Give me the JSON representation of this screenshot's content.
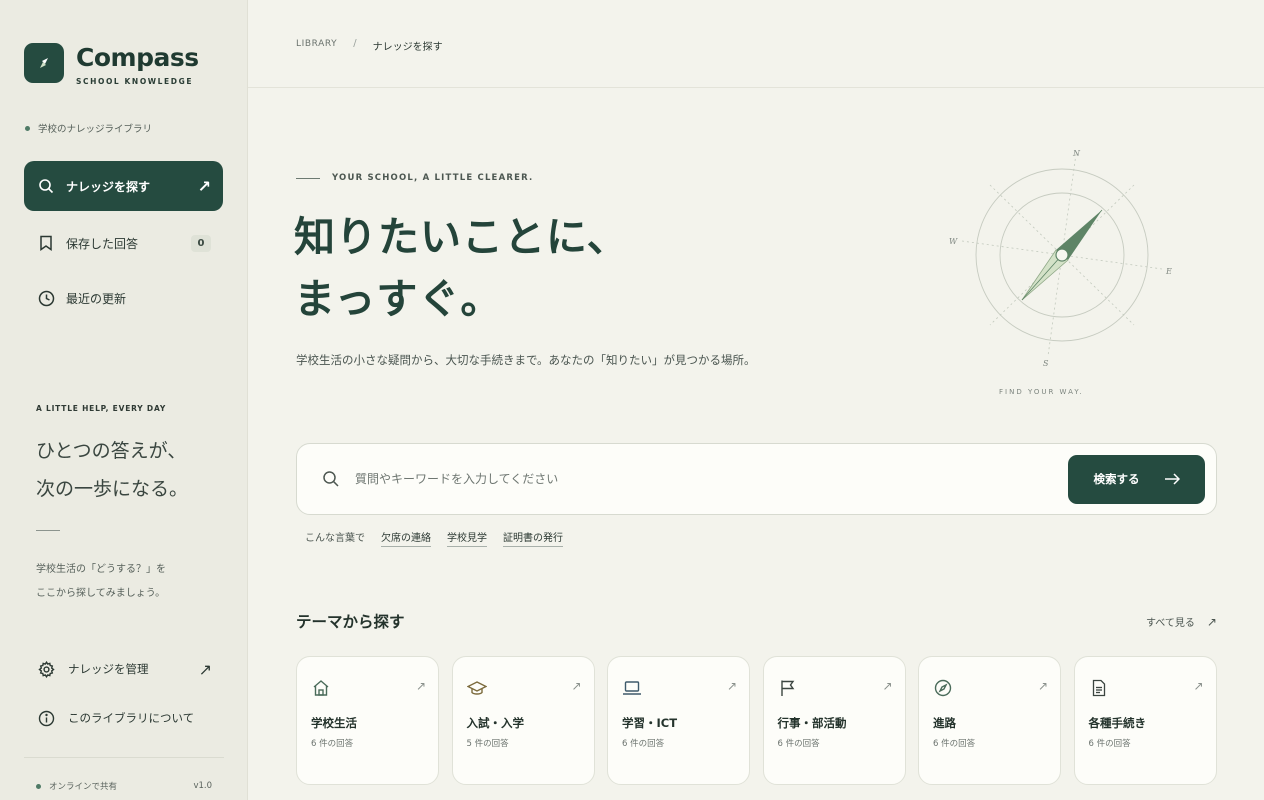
{
  "brand": {
    "name": "Compass",
    "subtitle": "SCHOOL KNOWLEDGE"
  },
  "sidebar": {
    "library_label": "学校のナレッジライブラリ",
    "nav": [
      {
        "label": "ナレッジを探す",
        "icon": "search-icon",
        "active": true
      },
      {
        "label": "保存した回答",
        "icon": "bookmark-icon",
        "badge": "0"
      },
      {
        "label": "最近の更新",
        "icon": "clock-icon"
      }
    ],
    "tagline_kicker": "A LITTLE HELP, EVERY DAY",
    "tagline_line1": "ひとつの答えが、",
    "tagline_line2": "次の一歩になる。",
    "desc_line1": "学校生活の「どうする？」を",
    "desc_line2": "ここから探してみましょう。",
    "bottom": [
      {
        "label": "ナレッジを管理",
        "icon": "gear-icon"
      },
      {
        "label": "このライブラリについて",
        "icon": "info-icon"
      }
    ],
    "footer_status": "オンラインで共有",
    "version": "v1.0"
  },
  "breadcrumb": {
    "root": "LIBRARY",
    "separator": "/",
    "current": "ナレッジを探す"
  },
  "hero": {
    "kicker": "YOUR SCHOOL, A LITTLE CLEARER.",
    "title_line1": "知りたいことに、",
    "title_line2": "まっすぐ。",
    "description": "学校生活の小さな疑問から、大切な手続きまで。あなたの「知りたい」が見つかる場所。",
    "compass_labels": {
      "n": "N",
      "e": "E",
      "s": "S",
      "w": "W"
    },
    "find_way": "FIND YOUR WAY."
  },
  "search": {
    "placeholder": "質問やキーワードを入力してください",
    "button_label": "検索する",
    "suggest_label": "こんな言葉で",
    "suggestions": [
      "欠席の連絡",
      "学校見学",
      "証明書の発行"
    ]
  },
  "themes": {
    "title": "テーマから探す",
    "see_all": "すべて見る",
    "cards": [
      {
        "title": "学校生活",
        "count": "6 件の回答",
        "icon": "house-icon"
      },
      {
        "title": "入試・入学",
        "count": "5 件の回答",
        "icon": "graduation-cap-icon"
      },
      {
        "title": "学習・ICT",
        "count": "6 件の回答",
        "icon": "laptop-icon"
      },
      {
        "title": "行事・部活動",
        "count": "6 件の回答",
        "icon": "flag-icon"
      },
      {
        "title": "進路",
        "count": "6 件の回答",
        "icon": "compass-icon"
      },
      {
        "title": "各種手続き",
        "count": "6 件の回答",
        "icon": "document-icon"
      }
    ]
  },
  "colors": {
    "accent": "#254b40",
    "background": "#f3f3ec",
    "sidebar": "#ebebe2",
    "compass_dark": "#5e8466",
    "compass_light": "#d4e2c8"
  }
}
